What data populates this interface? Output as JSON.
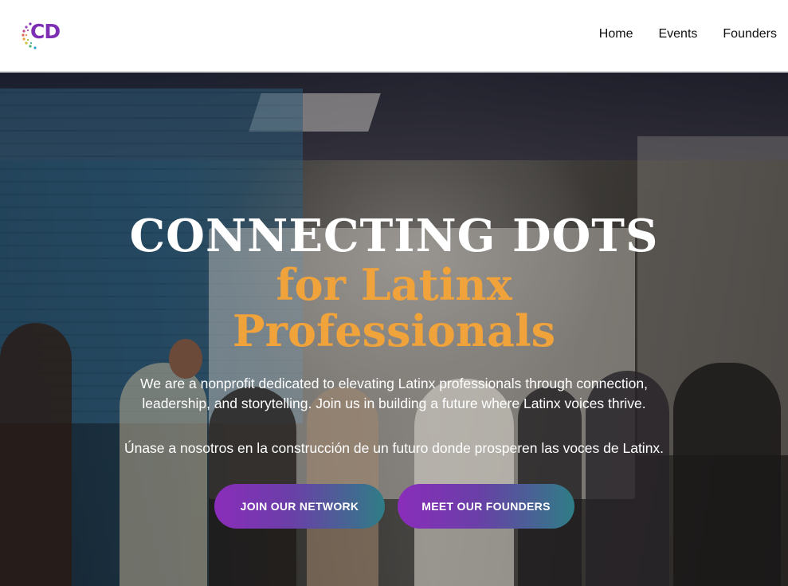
{
  "brand": {
    "logo_text": "CD",
    "logo_color": "#7e2fb3"
  },
  "nav": {
    "items": [
      "Home",
      "Events",
      "Founders"
    ]
  },
  "hero": {
    "title_line1": "CONNECTING DOTS",
    "title_line2": "for Latinx",
    "title_line3": "Professionals",
    "title_color": "#ffffff",
    "accent_color": "#f0a23b",
    "description_en": "We are a nonprofit dedicated to elevating Latinx professionals through connection, leadership, and storytelling. Join us in building a future where Latinx voices thrive.",
    "description_es": "Únase a nosotros en la construcción de un futuro donde prosperen las voces de Latinx.",
    "buttons": {
      "join_label": "JOIN OUR NETWORK",
      "founders_label": "MEET OUR FOUNDERS"
    },
    "button_gradient": [
      "#8a2dba",
      "#2f7d86"
    ]
  },
  "icons": {
    "logo": "connecting-dots-logo-icon"
  }
}
